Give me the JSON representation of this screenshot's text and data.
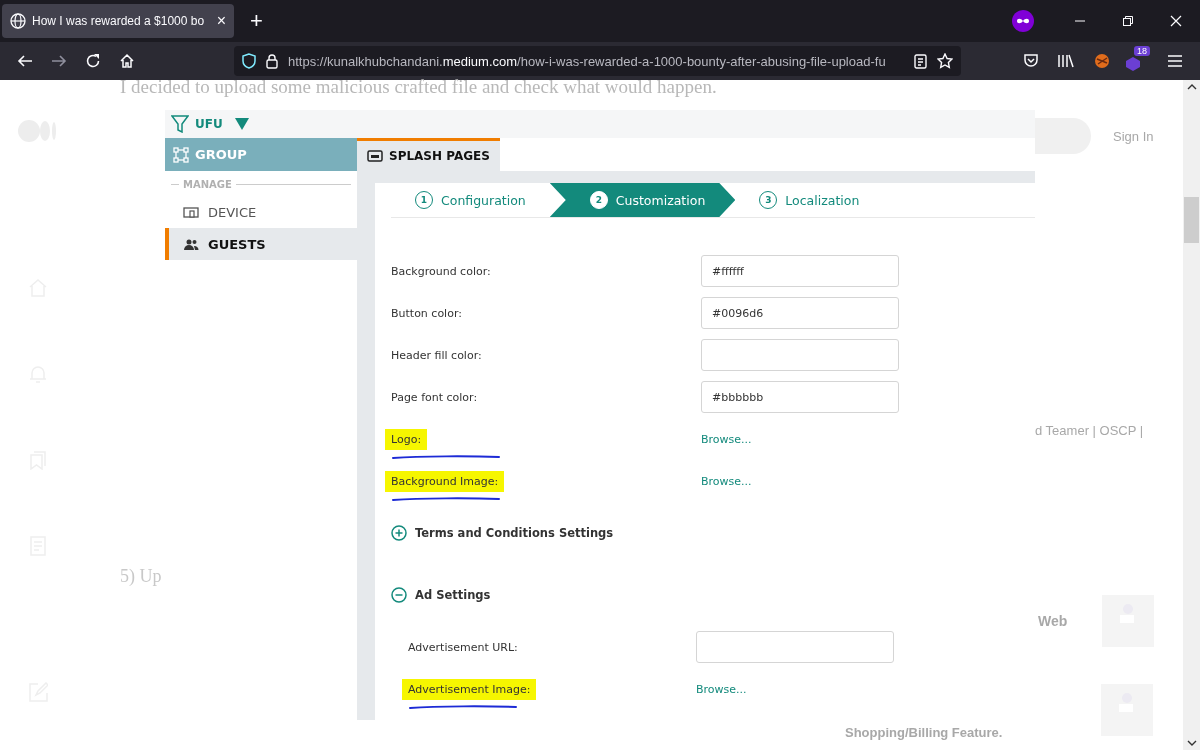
{
  "browser": {
    "tab_title": "How I was rewarded a $1000 bo",
    "close_tab": "×",
    "new_tab": "+",
    "url": "https://kunalkhubchandani.**medium.com**/how-i-was-rewarded-a-1000-bounty-after-abusing-file-upload-fu",
    "extension_badge": "18"
  },
  "article": {
    "lead_text": "I decided to upload some malicious crafted file and check what would happen.",
    "sign_in": "Sign In",
    "heading_fragment": "5) Up",
    "author_bio": "d Teamer | OSCP |",
    "related": [
      {
        "title": "Web"
      },
      {
        "title": "Shopping/Billing Feature."
      }
    ]
  },
  "screenshot": {
    "filter_label": "UFU",
    "sidebar": {
      "group": "GROUP",
      "section": "MANAGE",
      "items": [
        {
          "label": "DEVICE",
          "kind": "device",
          "selected": false
        },
        {
          "label": "GUESTS",
          "kind": "guests",
          "selected": true
        }
      ]
    },
    "tab": "SPLASH PAGES",
    "steps": [
      {
        "number": "1",
        "label": "Configuration",
        "selected": false
      },
      {
        "number": "2",
        "label": "Customization",
        "selected": true
      },
      {
        "number": "3",
        "label": "Localization",
        "selected": false
      }
    ],
    "fields": [
      {
        "kind": "text",
        "label": "Background color:",
        "value": "#ffffff",
        "highlighted": false
      },
      {
        "kind": "text",
        "label": "Button color:",
        "value": "#0096d6",
        "highlighted": false
      },
      {
        "kind": "text",
        "label": "Header fill color:",
        "highlighted": false
      },
      {
        "kind": "text",
        "label": "Page font color:",
        "value": "#bbbbbb",
        "highlighted": false
      },
      {
        "kind": "browse",
        "label": "Logo:",
        "link": "Browse...",
        "highlighted": true
      },
      {
        "kind": "browse",
        "label": "Background Image:",
        "link": "Browse...",
        "highlighted": true
      }
    ],
    "sections": [
      {
        "title": "Terms and Conditions Settings",
        "expanded": false
      },
      {
        "title": "Ad Settings",
        "expanded": true,
        "fields": [
          {
            "kind": "text",
            "label": "Advertisement URL:",
            "highlighted": false
          },
          {
            "kind": "browse",
            "label": "Advertisement Image:",
            "link": "Browse...",
            "highlighted": true
          }
        ]
      }
    ]
  }
}
